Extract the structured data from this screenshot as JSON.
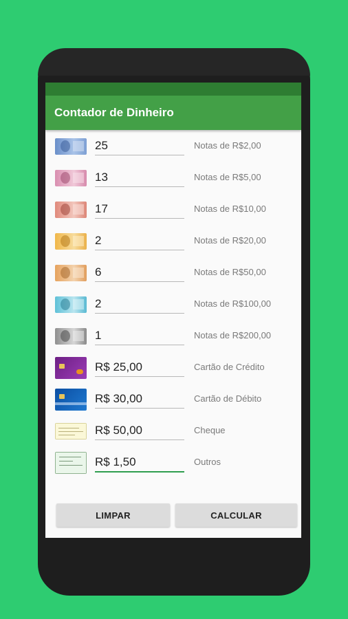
{
  "app": {
    "title": "Contador de Dinheiro"
  },
  "rows": [
    {
      "icon": "brl-2-banknote-icon",
      "value": "25",
      "label": "Notas de R$2,00"
    },
    {
      "icon": "brl-5-banknote-icon",
      "value": "13",
      "label": "Notas de R$5,00"
    },
    {
      "icon": "brl-10-banknote-icon",
      "value": "17",
      "label": "Notas de R$10,00"
    },
    {
      "icon": "brl-20-banknote-icon",
      "value": "2",
      "label": "Notas de R$20,00"
    },
    {
      "icon": "brl-50-banknote-icon",
      "value": "6",
      "label": "Notas de R$50,00"
    },
    {
      "icon": "brl-100-banknote-icon",
      "value": "2",
      "label": "Notas de R$100,00"
    },
    {
      "icon": "brl-200-banknote-icon",
      "value": "1",
      "label": "Notas de R$200,00"
    },
    {
      "icon": "credit-card-icon",
      "value": "R$ 25,00",
      "label": "Cartão de Crédito"
    },
    {
      "icon": "debit-card-icon",
      "value": "R$ 30,00",
      "label": "Cartão de Débito"
    },
    {
      "icon": "cheque-icon",
      "value": "R$ 50,00",
      "label": "Cheque"
    },
    {
      "icon": "other-payment-icon",
      "value": "R$ 1,50",
      "label": "Outros"
    }
  ],
  "buttons": {
    "clear": "LIMPAR",
    "calculate": "CALCULAR"
  },
  "colors": {
    "background": "#2ecc71",
    "appbar": "#43a047",
    "statusbar": "#2e7d32",
    "accent": "#2e9d4e"
  }
}
